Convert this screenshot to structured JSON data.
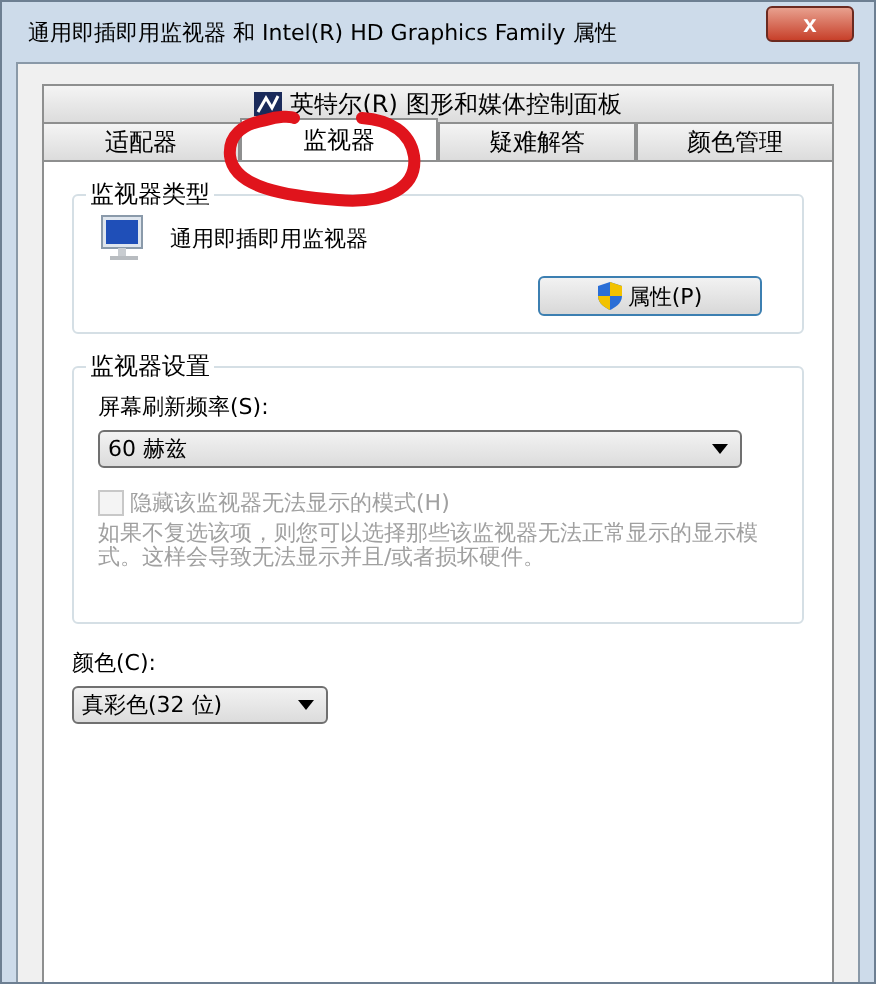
{
  "window": {
    "title": "通用即插即用监视器 和 Intel(R) HD Graphics Family 属性",
    "close": "x"
  },
  "tab_rows": [
    [
      {
        "label": "英特尔(R) 图形和媒体控制面板",
        "icon": true,
        "selected": false
      }
    ],
    [
      {
        "label": "适配器",
        "selected": false
      },
      {
        "label": "监视器",
        "selected": true
      },
      {
        "label": "疑难解答",
        "selected": false
      },
      {
        "label": "颜色管理",
        "selected": false
      }
    ]
  ],
  "highlight": {
    "kind": "circle"
  },
  "monitor_type": {
    "title": "监视器类型",
    "name": "通用即插即用监视器",
    "button": "属性(P)"
  },
  "monitor_settings": {
    "title": "监视器设置",
    "refresh_label": "屏幕刷新频率(S):",
    "refresh_value": "60 赫兹",
    "hide_modes": {
      "label": "隐藏该监视器无法显示的模式(H)",
      "checked": false,
      "disabled": true
    },
    "note": "如果不复选该项，则您可以选择那些该监视器无法正常显示的显示模式。这样会导致无法显示并且/或者损坏硬件。"
  },
  "color": {
    "label": "颜色(C):",
    "value": "真彩色(32 位)"
  }
}
